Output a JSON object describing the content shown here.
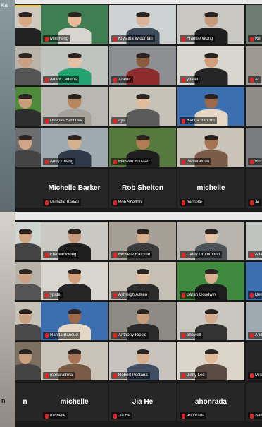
{
  "left_strip": {
    "top_text": "Ka",
    "bottom_text": "n"
  },
  "panel_top": {
    "rows": [
      [
        {
          "name": "",
          "style": "photo",
          "bg": "#cfc9bd",
          "skin": "#d8a783",
          "shirt": "#222",
          "active": true
        },
        {
          "name": "Miki Fang",
          "style": "photo",
          "bg": "#3f7d52",
          "skin": "#e8b89a",
          "shirt": "#d8d4cf"
        },
        {
          "name": "Krystina Widdman",
          "style": "photo",
          "bg": "#cfd2d2",
          "skin": "#d9b49b",
          "shirt": "#3d4a5a"
        },
        {
          "name": "Frankie Wong",
          "style": "photo",
          "bg": "#c9c8c2",
          "skin": "#c69a7a",
          "shirt": "#1f1f1f"
        },
        {
          "name": "Re",
          "style": "photo",
          "bg": "#6e7c73",
          "skin": "#c9a183",
          "shirt": "#333"
        }
      ],
      [
        {
          "name": "",
          "style": "photo",
          "bg": "#b9b3aa",
          "skin": "#c8a081",
          "shirt": "#555"
        },
        {
          "name": "Adam Ladkins",
          "style": "photo",
          "bg": "#bfc4c0",
          "skin": "#e6c1a5",
          "shirt": "#23a36f"
        },
        {
          "name": "zzamir",
          "style": "photo",
          "bg": "#8d8f93",
          "skin": "#8a5b3c",
          "shirt": "#8d2c2c"
        },
        {
          "name": "ypatel",
          "style": "photo",
          "bg": "#d9d6cf",
          "skin": "#d1a07a",
          "shirt": "#262626"
        },
        {
          "name": "Ar",
          "style": "photo",
          "bg": "#9e9a92",
          "skin": "#d5ad8c",
          "shirt": "#3a3a3a"
        }
      ],
      [
        {
          "name": "",
          "style": "photo",
          "bg": "#4f8a3a",
          "skin": "#c79c7a",
          "shirt": "#2d2d2d"
        },
        {
          "name": "Deepak Sachdev",
          "style": "photo",
          "bg": "#b8b7b1",
          "skin": "#b9875f",
          "shirt": "#a7a39b"
        },
        {
          "name": "ayu",
          "style": "photo",
          "bg": "#c7c2b7",
          "skin": "#e0bc9d",
          "shirt": "#5a5a5a"
        },
        {
          "name": "Randa Bancud",
          "style": "photo",
          "bg": "#3b6fb0",
          "skin": "#9a6a4a",
          "shirt": "#e5d9c5"
        },
        {
          "name": "",
          "style": "photo",
          "bg": "#8f8c87",
          "skin": "#caa284",
          "shirt": "#3e3e3e"
        }
      ],
      [
        {
          "name": "",
          "style": "photo",
          "bg": "#6c6d6e",
          "skin": "#cfa585",
          "shirt": "#444"
        },
        {
          "name": "Andy Chang",
          "style": "photo",
          "bg": "#9fa9b0",
          "skin": "#d7b08e",
          "shirt": "#2e3a4a"
        },
        {
          "name": "Marwan Youssef",
          "style": "photo",
          "bg": "#567a3e",
          "skin": "#b27c57",
          "shirt": "#1e1e1e"
        },
        {
          "name": "rsenarathna",
          "style": "photo",
          "bg": "#c9c3b8",
          "skin": "#a77453",
          "shirt": "#7a5b47"
        },
        {
          "name": "Robert",
          "style": "photo",
          "bg": "#7a7c7d",
          "skin": "#d2aa8a",
          "shirt": "#333"
        }
      ],
      [
        {
          "name": "",
          "style": "avatar",
          "display": ""
        },
        {
          "name": "Michelle Barker",
          "style": "avatar",
          "display": "Michelle Barker"
        },
        {
          "name": "Rob Shelton",
          "style": "avatar",
          "display": "Rob Shelton"
        },
        {
          "name": "michelle",
          "style": "avatar",
          "display": "michelle"
        },
        {
          "name": "Jo",
          "style": "avatar",
          "display": ""
        }
      ]
    ]
  },
  "panel_bottom": {
    "rows": [
      [
        {
          "name": "",
          "style": "photo",
          "bg": "#cfd6d1",
          "skin": "#d1a683",
          "shirt": "#444"
        },
        {
          "name": "Frankie Wong",
          "style": "photo",
          "bg": "#c9c8c2",
          "skin": "#c69a7a",
          "shirt": "#1f1f1f"
        },
        {
          "name": "Michelle Ratcliffe",
          "style": "photo",
          "bg": "#a69f95",
          "skin": "#d7ae8e",
          "shirt": "#3b3b3b"
        },
        {
          "name": "Cathy Drummond",
          "style": "photo",
          "bg": "#b7b5ae",
          "skin": "#e2c2aa",
          "shirt": "#4d5158"
        },
        {
          "name": "Adam Lad",
          "style": "photo",
          "bg": "#bfc4c0",
          "skin": "#e6c1a5",
          "shirt": "#23a36f"
        }
      ],
      [
        {
          "name": "",
          "style": "photo",
          "bg": "#b8b3a9",
          "skin": "#caa283",
          "shirt": "#555"
        },
        {
          "name": "ypatel",
          "style": "photo",
          "bg": "#d9d6cf",
          "skin": "#d1a07a",
          "shirt": "#262626"
        },
        {
          "name": "Ashleigh Aitken",
          "style": "photo",
          "bg": "#c6bfb3",
          "skin": "#e4c0a2",
          "shirt": "#2b2b2b"
        },
        {
          "name": "Sarah Goodwin",
          "style": "photo",
          "bg": "#3f8a3f",
          "skin": "#d9b092",
          "shirt": "#1e1e1e"
        },
        {
          "name": "Deepak",
          "style": "photo",
          "bg": "#3b6fb0",
          "skin": "#b9875f",
          "shirt": "#a7a39b"
        }
      ],
      [
        {
          "name": "",
          "style": "photo",
          "bg": "#c7c1b5",
          "skin": "#c9a081",
          "shirt": "#4a4a4a"
        },
        {
          "name": "Randa Bancud",
          "style": "photo",
          "bg": "#3b6fb0",
          "skin": "#9a6a4a",
          "shirt": "#e5d9c5"
        },
        {
          "name": "Anthony Riccio",
          "style": "photo",
          "bg": "#8d8a84",
          "skin": "#c89d7b",
          "shirt": "#2a2a2a"
        },
        {
          "name": "bnewell",
          "style": "photo",
          "bg": "#c9c6c0",
          "skin": "#d2ab8c",
          "shirt": "#333"
        },
        {
          "name": "Andy Ch",
          "style": "photo",
          "bg": "#9fa9b0",
          "skin": "#d7b08e",
          "shirt": "#2e3a4a"
        }
      ],
      [
        {
          "name": "",
          "style": "photo",
          "bg": "#7b6f60",
          "skin": "#c99f7e",
          "shirt": "#444"
        },
        {
          "name": "rsenarathna",
          "style": "photo",
          "bg": "#c9c3b8",
          "skin": "#a77453",
          "shirt": "#7a5b47"
        },
        {
          "name": "Robert Pestana",
          "style": "photo",
          "bg": "#c8c4bd",
          "skin": "#d7ae8e",
          "shirt": "#3f4e63"
        },
        {
          "name": "Jinny Lee",
          "style": "photo",
          "bg": "#dcd6ca",
          "skin": "#e0b998",
          "shirt": "#5a4b42"
        },
        {
          "name": "Michelle",
          "style": "avatar",
          "display": "Miche"
        }
      ],
      [
        {
          "name": "",
          "style": "avatar",
          "display": "n"
        },
        {
          "name": "michelle",
          "style": "avatar",
          "display": "michelle"
        },
        {
          "name": "Jia He",
          "style": "avatar",
          "display": "Jia He"
        },
        {
          "name": "ahonrada",
          "style": "avatar",
          "display": "ahonrada"
        },
        {
          "name": "Sam",
          "style": "avatar",
          "display": ""
        }
      ]
    ]
  }
}
